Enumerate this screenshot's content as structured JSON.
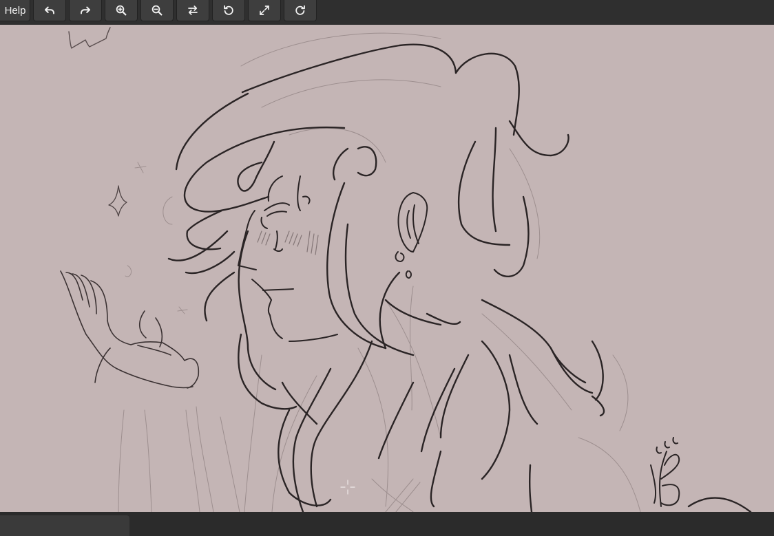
{
  "toolbar": {
    "help_label": "Help",
    "buttons": [
      {
        "name": "undo-button",
        "icon": "undo-icon"
      },
      {
        "name": "redo-button",
        "icon": "redo-icon"
      },
      {
        "name": "zoom-in-button",
        "icon": "zoom-in-icon"
      },
      {
        "name": "zoom-out-button",
        "icon": "zoom-out-icon"
      },
      {
        "name": "flip-button",
        "icon": "flip-arrows-icon"
      },
      {
        "name": "rotate-left-button",
        "icon": "rotate-ccw-icon"
      },
      {
        "name": "fit-screen-button",
        "icon": "expand-icon"
      },
      {
        "name": "rotate-right-button",
        "icon": "rotate-cw-icon"
      }
    ]
  },
  "canvas": {
    "background": "#c4b5b5",
    "stroke_color": "#2a2425"
  },
  "colors": {
    "toolbar_bg": "#2f2f2f",
    "button_bg": "#3e3e3e",
    "icon": "#f2f2f2"
  }
}
